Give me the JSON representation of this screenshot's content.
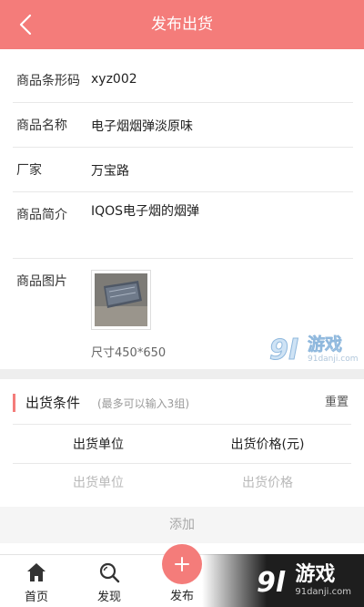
{
  "header": {
    "title": "发布出货",
    "back_icon": "chevron-left-icon"
  },
  "form": {
    "barcode": {
      "label": "商品条形码",
      "value": "xyz002"
    },
    "name": {
      "label": "商品名称",
      "value": "电子烟烟弹淡原味"
    },
    "maker": {
      "label": "厂家",
      "value": "万宝路"
    },
    "intro": {
      "label": "商品简介",
      "value": "IQOS电子烟的烟弹"
    },
    "image": {
      "label": "商品图片",
      "size_note": "尺寸450*650"
    }
  },
  "shipping": {
    "title": "出货条件",
    "hint": "(最多可以输入3组)",
    "reset_label": "重置",
    "columns": [
      "出货单位",
      "出货价格(元)"
    ],
    "placeholders": {
      "unit": "出货单位",
      "price": "出货价格"
    },
    "add_label": "添加"
  },
  "tabbar": {
    "items": [
      {
        "label": "首页",
        "icon": "home-icon"
      },
      {
        "label": "发现",
        "icon": "search-icon"
      },
      {
        "label": "发布",
        "icon": "plus-icon"
      }
    ]
  },
  "watermark": {
    "text": "游戏",
    "site": "91danji.com",
    "logo": "9l"
  },
  "colors": {
    "accent": "#f47c7a",
    "background": "#eeeeee"
  }
}
